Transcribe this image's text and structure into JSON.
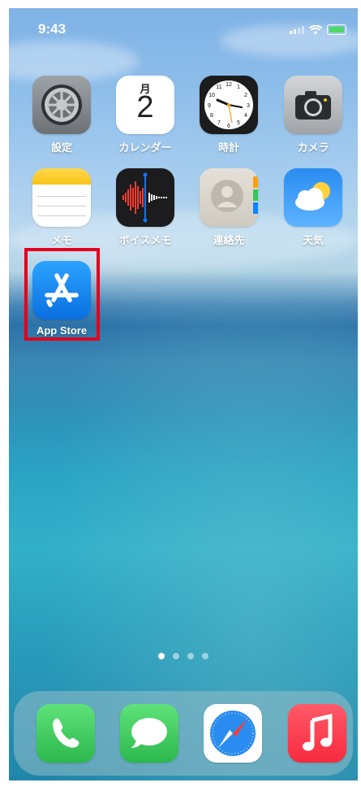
{
  "status_bar": {
    "time": "9:43"
  },
  "apps": [
    {
      "label": "設定",
      "icon": "settings-gear-icon"
    },
    {
      "label": "カレンダー",
      "icon": "calendar-icon",
      "month": "月",
      "day": "2"
    },
    {
      "label": "時計",
      "icon": "clock-icon"
    },
    {
      "label": "カメラ",
      "icon": "camera-icon"
    },
    {
      "label": "メモ",
      "icon": "notes-icon"
    },
    {
      "label": "ボイスメモ",
      "icon": "voice-memo-icon"
    },
    {
      "label": "連絡先",
      "icon": "contacts-icon"
    },
    {
      "label": "天気",
      "icon": "weather-icon"
    },
    {
      "label": "App Store",
      "icon": "app-store-icon"
    }
  ],
  "page_indicator": {
    "count": 4,
    "active": 1
  },
  "dock": [
    {
      "icon": "phone-icon"
    },
    {
      "icon": "messages-icon"
    },
    {
      "icon": "safari-compass-icon"
    },
    {
      "icon": "music-icon"
    }
  ],
  "colors": {
    "highlight": "#e3001b",
    "app_store": "#1a8cf0",
    "phone_green": "#34c759",
    "music_red": "#fc3c44"
  }
}
